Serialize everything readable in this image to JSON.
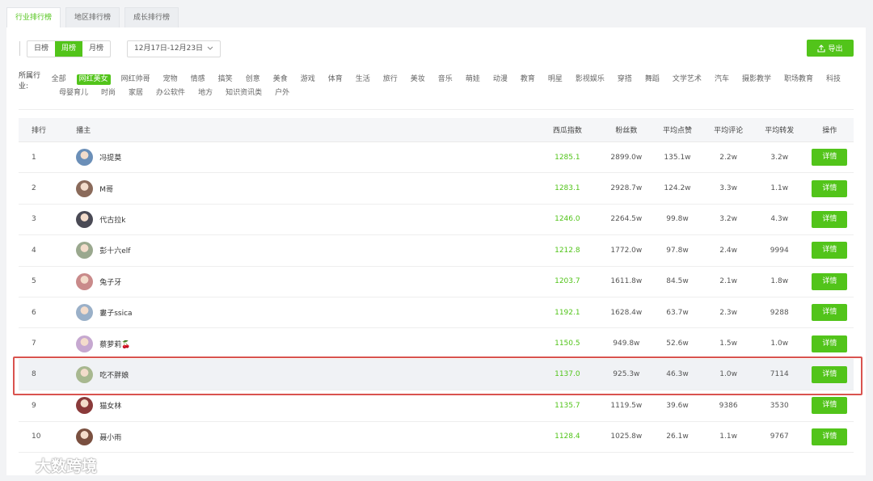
{
  "tabs": [
    "行业排行榜",
    "地区排行榜",
    "成长排行榜"
  ],
  "period_buttons": [
    "日榜",
    "周榜",
    "月榜"
  ],
  "date_range": "12月17日-12月23日",
  "export_label": "导出",
  "category_label": "所属行业:",
  "categories_row1": [
    "全部",
    "网红美女",
    "网红帅哥",
    "宠物",
    "情感",
    "搞笑",
    "创意",
    "美食",
    "游戏",
    "体育",
    "生活",
    "旅行",
    "美妆",
    "音乐",
    "萌娃",
    "动漫",
    "教育",
    "明星",
    "影视娱乐",
    "穿搭",
    "舞蹈",
    "文学艺术",
    "汽车",
    "摄影教学",
    "职场教育",
    "科技"
  ],
  "categories_row2": [
    "母婴育儿",
    "时尚",
    "家居",
    "办公软件",
    "地方",
    "知识资讯类",
    "户外"
  ],
  "headers": {
    "rank": "排行",
    "host": "播主",
    "xigua": "西瓜指数",
    "fans": "粉丝数",
    "like": "平均点赞",
    "comment": "平均评论",
    "share": "平均转发",
    "op": "操作"
  },
  "detail_label": "详情",
  "rows": [
    {
      "rank": "1",
      "name": "冯提莫",
      "xigua": "1285.1",
      "fans": "2899.0w",
      "like": "135.1w",
      "comment": "2.2w",
      "share": "3.2w",
      "avatar_color": "#6b8fb8"
    },
    {
      "rank": "2",
      "name": "M哥",
      "xigua": "1283.1",
      "fans": "2928.7w",
      "like": "124.2w",
      "comment": "3.3w",
      "share": "1.1w",
      "avatar_color": "#8a6a5a"
    },
    {
      "rank": "3",
      "name": "代古拉k",
      "xigua": "1246.0",
      "fans": "2264.5w",
      "like": "99.8w",
      "comment": "3.2w",
      "share": "4.3w",
      "avatar_color": "#4a4a55"
    },
    {
      "rank": "4",
      "name": "彭十六elf",
      "xigua": "1212.8",
      "fans": "1772.0w",
      "like": "97.8w",
      "comment": "2.4w",
      "share": "9994",
      "avatar_color": "#9aa88e"
    },
    {
      "rank": "5",
      "name": "兔子牙",
      "xigua": "1203.7",
      "fans": "1611.8w",
      "like": "84.5w",
      "comment": "2.1w",
      "share": "1.8w",
      "avatar_color": "#c98a8a"
    },
    {
      "rank": "6",
      "name": "婁子ssica",
      "xigua": "1192.1",
      "fans": "1628.4w",
      "like": "63.7w",
      "comment": "2.3w",
      "share": "9288",
      "avatar_color": "#9ab0c8"
    },
    {
      "rank": "7",
      "name": "蔡萝莉🍒",
      "xigua": "1150.5",
      "fans": "949.8w",
      "like": "52.6w",
      "comment": "1.5w",
      "share": "1.0w",
      "avatar_color": "#c6a8d0"
    },
    {
      "rank": "8",
      "name": "吃不胖娘",
      "xigua": "1137.0",
      "fans": "925.3w",
      "like": "46.3w",
      "comment": "1.0w",
      "share": "7114",
      "avatar_color": "#a8b890"
    },
    {
      "rank": "9",
      "name": "猫女林",
      "xigua": "1135.7",
      "fans": "1119.5w",
      "like": "39.6w",
      "comment": "9386",
      "share": "3530",
      "avatar_color": "#8a3a3a"
    },
    {
      "rank": "10",
      "name": "聂小雨",
      "xigua": "1128.4",
      "fans": "1025.8w",
      "like": "26.1w",
      "comment": "1.1w",
      "share": "9767",
      "avatar_color": "#7a5040"
    }
  ],
  "watermark": "大数跨境"
}
